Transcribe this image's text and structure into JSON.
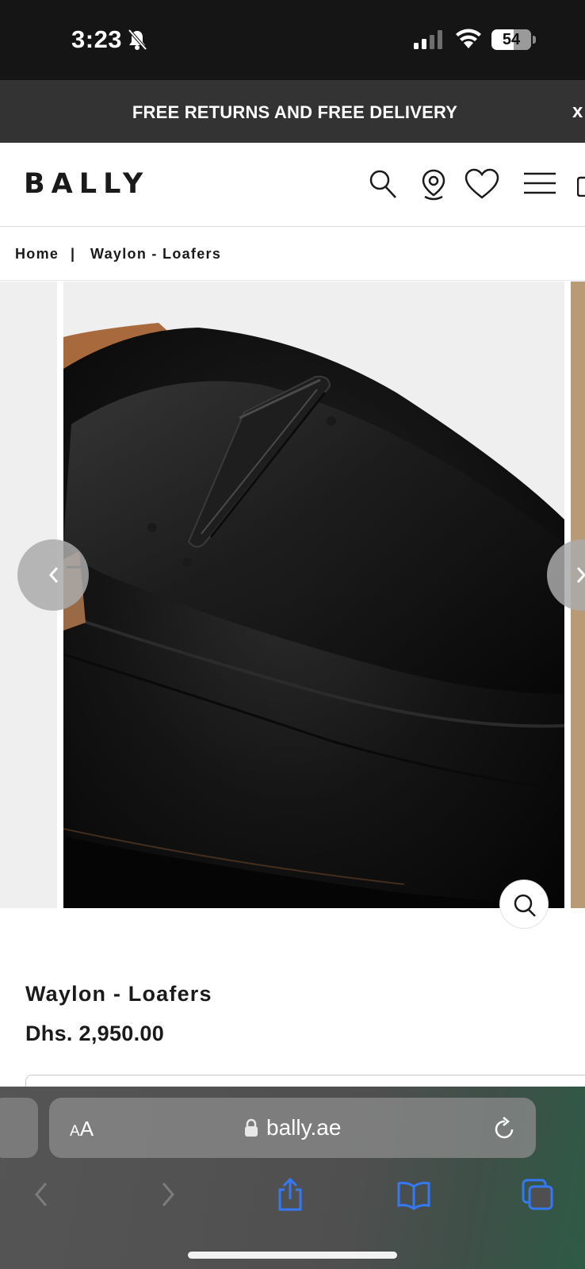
{
  "status_bar": {
    "time": "3:23",
    "battery": "54",
    "icons": [
      "bell-slash-icon",
      "cellular-signal-icon",
      "wifi-icon",
      "battery-icon"
    ]
  },
  "promo": {
    "text": "FREE RETURNS AND FREE DELIVERY",
    "close_label": "x"
  },
  "header": {
    "logo": "BALLY",
    "icons": [
      "search-icon",
      "store-locator-icon",
      "wishlist-heart-icon",
      "menu-icon",
      "bag-icon"
    ]
  },
  "breadcrumb": {
    "home": "Home",
    "separator": "|",
    "current": "Waylon - Loafers"
  },
  "gallery": {
    "image_alt": "Black leather loafer close-up",
    "prev_icon": "chevron-left-icon",
    "next_icon": "chevron-right-icon",
    "zoom_icon": "zoom-search-icon"
  },
  "product": {
    "name": "Waylon - Loafers",
    "price": "Dhs. 2,950.00"
  },
  "browser": {
    "aa_small": "A",
    "aa_large": "A",
    "url": "bally.ae",
    "toolbar": [
      "back-icon",
      "forward-icon",
      "share-icon",
      "bookmarks-icon",
      "tabs-icon"
    ]
  },
  "colors": {
    "status_bar_bg": "#151515",
    "promo_bg": "#333333",
    "text_dark": "#1a1a1a",
    "safari_link_blue": "#3478f6"
  }
}
